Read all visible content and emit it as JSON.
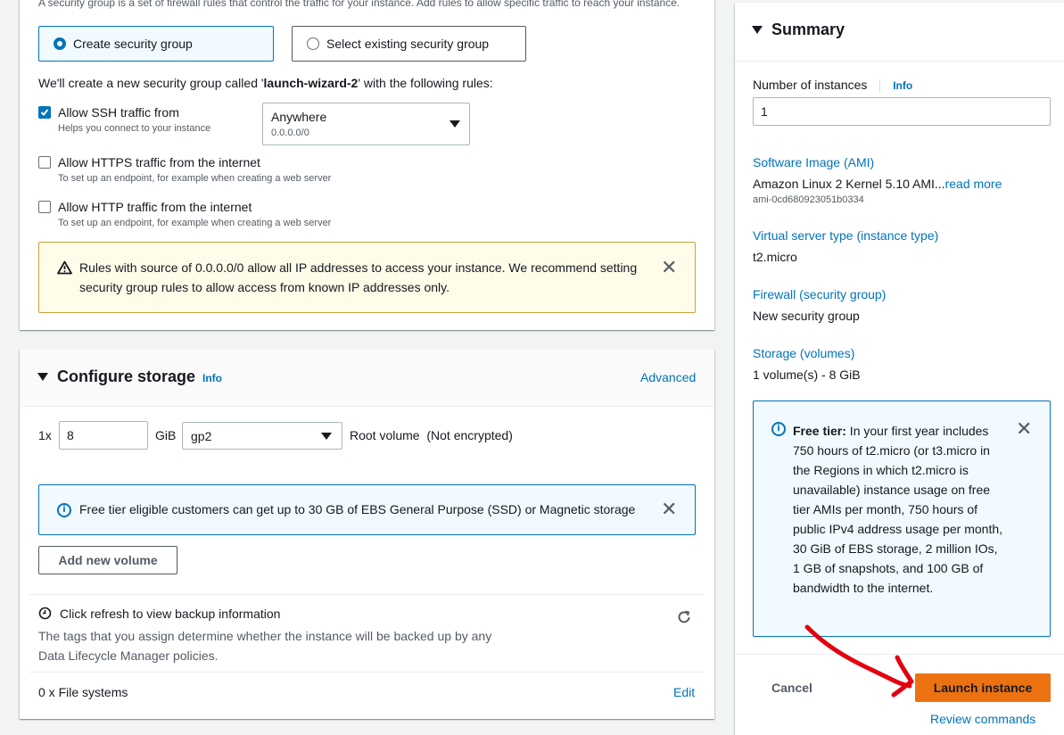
{
  "security_group": {
    "description": "A security group is a set of firewall rules that control the traffic for your instance. Add rules to allow specific traffic to reach your instance.",
    "create_option": "Create security group",
    "select_option": "Select existing security group",
    "note_prefix": "We'll create a new security group called '",
    "group_name": "launch-wizard-2",
    "note_suffix": "' with the following rules:",
    "ssh": {
      "label": "Allow SSH traffic from",
      "help": "Helps you connect to your instance",
      "checked": true
    },
    "ssh_source": {
      "value": "Anywhere",
      "sub": "0.0.0.0/0"
    },
    "https": {
      "label": "Allow HTTPS traffic from the internet",
      "help": "To set up an endpoint, for example when creating a web server",
      "checked": false
    },
    "http": {
      "label": "Allow HTTP traffic from the internet",
      "help": "To set up an endpoint, for example when creating a web server",
      "checked": false
    },
    "warning": "Rules with source of 0.0.0.0/0 allow all IP addresses to access your instance. We recommend setting security group rules to allow access from known IP addresses only."
  },
  "storage": {
    "title": "Configure storage",
    "info": "Info",
    "advanced": "Advanced",
    "count_prefix": "1x",
    "size": "8",
    "unit": "GiB",
    "volume_type": "gp2",
    "root_label": "Root volume  (Not encrypted)",
    "free_tier_info": "Free tier eligible customers can get up to 30 GB of EBS General Purpose (SSD) or Magnetic storage",
    "add_volume": "Add new volume",
    "backup_title": "Click refresh to view backup information",
    "backup_desc": "The tags that you assign determine whether the instance will be backed up by any Data Lifecycle Manager policies.",
    "file_systems": "0 x File systems",
    "edit": "Edit"
  },
  "summary": {
    "title": "Summary",
    "num_instances_label": "Number of instances",
    "info": "Info",
    "num_instances": "1",
    "ami_label": "Software Image (AMI)",
    "ami_value": "Amazon Linux 2 Kernel 5.10 AMI...",
    "read_more": "read more",
    "ami_id": "ami-0cd680923051b0334",
    "type_label": "Virtual server type (instance type)",
    "type_value": "t2.micro",
    "firewall_label": "Firewall (security group)",
    "firewall_value": "New security group",
    "storage_label": "Storage (volumes)",
    "storage_value": "1 volume(s) - 8 GiB",
    "free_tier_bold": "Free tier:",
    "free_tier_text": " In your first year includes 750 hours of t2.micro (or t3.micro in the Regions in which t2.micro is unavailable) instance usage on free tier AMIs per month, 750 hours of public IPv4 address usage per month, 30 GiB of EBS storage, 2 million IOs, 1 GB of snapshots, and 100 GB of bandwidth to the internet.",
    "cancel": "Cancel",
    "launch": "Launch instance",
    "review": "Review commands"
  },
  "colors": {
    "accent": "#0073bb",
    "primary_button": "#ec7211",
    "annotation": "#e3000f"
  }
}
